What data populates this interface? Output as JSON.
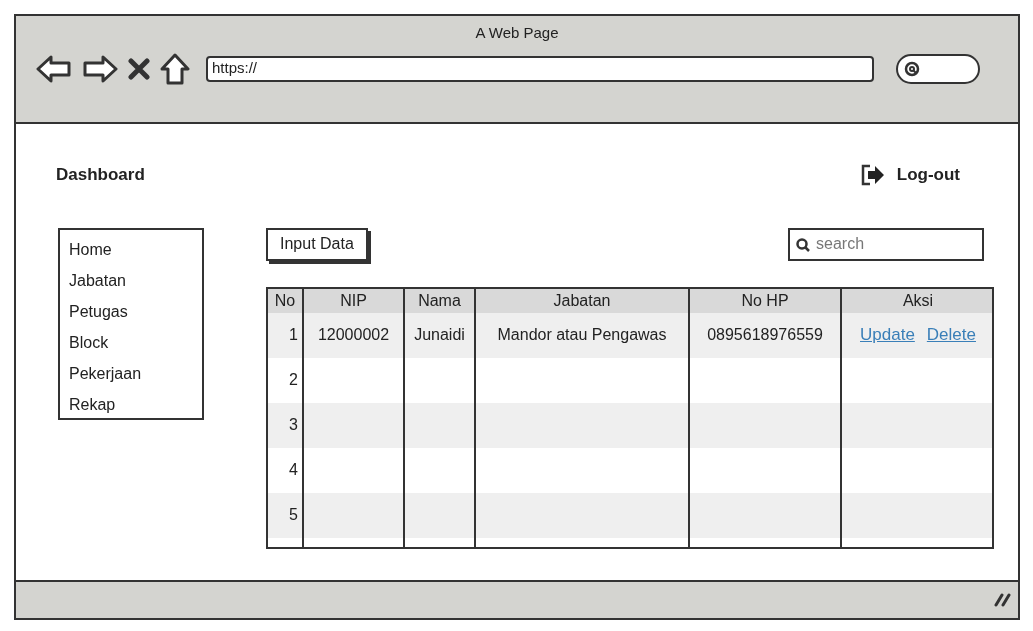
{
  "window": {
    "title": "A Web Page",
    "address": "https://"
  },
  "header": {
    "title": "Dashboard",
    "logout": "Log-out"
  },
  "sidebar": {
    "items": [
      {
        "label": "Home"
      },
      {
        "label": "Jabatan"
      },
      {
        "label": "Petugas"
      },
      {
        "label": "Block"
      },
      {
        "label": "Pekerjaan"
      },
      {
        "label": "Rekap"
      }
    ]
  },
  "toolbar": {
    "button": "Input Data",
    "search": {
      "placeholder": "search"
    }
  },
  "table": {
    "columns": [
      "No",
      "NIP",
      "Nama",
      "Jabatan",
      "No HP",
      "Aksi"
    ],
    "rows": [
      {
        "no": "1",
        "nip": "12000002",
        "nama": "Junaidi",
        "jabatan": "Mandor atau Pengawas",
        "no_hp": "0895618976559",
        "actions": [
          "Update",
          "Delete"
        ]
      },
      {
        "no": "2"
      },
      {
        "no": "3"
      },
      {
        "no": "4"
      },
      {
        "no": "5"
      }
    ]
  }
}
